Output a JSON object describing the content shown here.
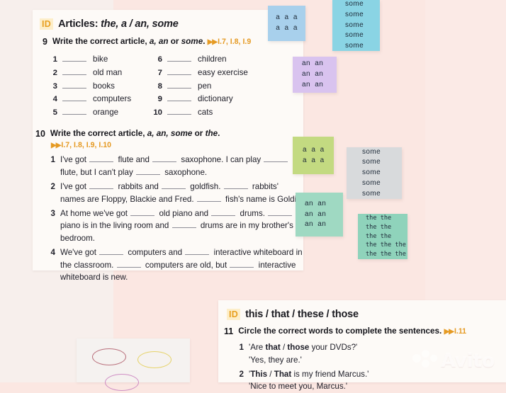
{
  "page": {
    "background_color": "#fbe7e2",
    "card_color": "#fdfaf7"
  },
  "card_articles": {
    "id_badge": "ID",
    "title_plain": "Articles: ",
    "title_italic": "the, a / an, some",
    "exercise_9": {
      "number": "9",
      "instruction_plain_1": "Write the correct article, ",
      "instruction_italic_1": "a, an",
      "instruction_plain_2": " or ",
      "instruction_italic_2": "some",
      "instruction_plain_3": ".",
      "reference": "I.7, I.8, I.9",
      "items_left": [
        {
          "n": "1",
          "text": "bike"
        },
        {
          "n": "2",
          "text": "old man"
        },
        {
          "n": "3",
          "text": "books"
        },
        {
          "n": "4",
          "text": "computers"
        },
        {
          "n": "5",
          "text": "orange"
        }
      ],
      "items_right": [
        {
          "n": "6",
          "text": "children"
        },
        {
          "n": "7",
          "text": "easy exercise"
        },
        {
          "n": "8",
          "text": "pen"
        },
        {
          "n": "9",
          "text": "dictionary"
        },
        {
          "n": "10",
          "text": "cats"
        }
      ]
    },
    "exercise_10": {
      "number": "10",
      "instruction_plain_1": "Write the correct article, ",
      "instruction_italic_1": "a, an, some",
      "instruction_plain_2": " or ",
      "instruction_italic_2": "the",
      "instruction_plain_3": ".",
      "reference": "I.7, I.8, I.9, I.10",
      "sentences": [
        {
          "n": "1",
          "parts": [
            "I've got ",
            "BLANK",
            " flute and ",
            "BLANK",
            " saxophone. I can play ",
            "BLANK",
            " flute, but I can't play ",
            "BLANK",
            " saxophone."
          ]
        },
        {
          "n": "2",
          "parts": [
            "I've got ",
            "BLANK",
            " rabbits and ",
            "BLANK",
            " goldfish. ",
            "BLANK",
            " rabbits' names are Floppy, Blackie and Fred. ",
            "BLANK",
            " fish's name is Goldie."
          ]
        },
        {
          "n": "3",
          "parts": [
            "At home we've got ",
            "BLANK",
            " old piano and ",
            "BLANK",
            " drums. ",
            "BLANK",
            " piano is in the living room and ",
            "BLANK",
            " drums are in my brother's bedroom."
          ]
        },
        {
          "n": "4",
          "parts": [
            "We've got ",
            "BLANK",
            " computers and ",
            "BLANK",
            " interactive whiteboard in the classroom. ",
            "BLANK",
            " computers are old, but ",
            "BLANK",
            " interactive whiteboard is new."
          ]
        }
      ]
    }
  },
  "card_demonstratives": {
    "id_badge": "ID",
    "title_italic": "this / that / these / those",
    "exercise_11": {
      "number": "11",
      "instruction": "Circle the correct words to complete the sentences.",
      "reference": "I.11",
      "sentences": [
        {
          "n": "1",
          "line1_pre": "'Are ",
          "line1_bold_a": "that",
          "line1_slash": " / ",
          "line1_bold_b": "those",
          "line1_post": " your DVDs?'",
          "line2": "'Yes, they are.'"
        },
        {
          "n": "2",
          "line1_pre": "'",
          "line1_bold_a": "This",
          "line1_slash": " / ",
          "line1_bold_b": "That",
          "line1_post": " is my friend Marcus.'",
          "line2": "'Nice to meet you, Marcus.'"
        }
      ]
    }
  },
  "sticky_notes": [
    {
      "name": "note-a-blue",
      "color": "#a8d0ec",
      "lines": [
        "a  a  a",
        "a  a  a"
      ]
    },
    {
      "name": "note-some-teal",
      "color": "#8ad4e4",
      "lines": [
        "some",
        "some",
        "some",
        "some",
        "some"
      ]
    },
    {
      "name": "note-an-purple",
      "color": "#d9c3ef",
      "lines": [
        "an  an",
        "an  an",
        "an  an"
      ]
    },
    {
      "name": "note-a-green",
      "color": "#c3da81",
      "lines": [
        "a  a  a",
        "a  a  a"
      ]
    },
    {
      "name": "note-some-gray",
      "color": "#d8dadc",
      "lines": [
        "some",
        "some",
        "some",
        "some",
        "some"
      ]
    },
    {
      "name": "note-an-mint",
      "color": "#9fd9c2",
      "lines": [
        "an  an",
        "an  an",
        "an  an"
      ]
    },
    {
      "name": "note-the-mint",
      "color": "#8fd3bb",
      "lines": [
        "the the",
        "the the",
        "the the",
        "the the the",
        "the the the"
      ]
    }
  ],
  "scrap_card": {
    "ellipses": [
      {
        "color": "#b9707c"
      },
      {
        "color": "#e6d36a"
      },
      {
        "color": "#cf8fc4"
      }
    ]
  },
  "watermark": {
    "text": "Avito"
  }
}
